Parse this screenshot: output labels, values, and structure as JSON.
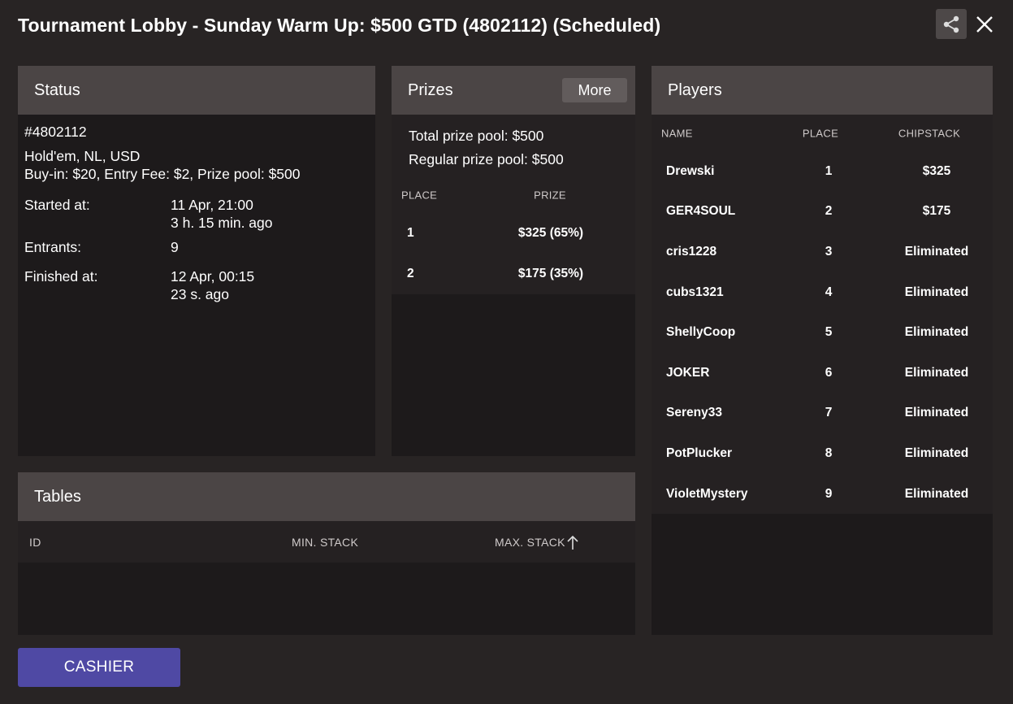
{
  "window": {
    "title": "Tournament Lobby - Sunday Warm Up: $500 GTD (4802112) (Scheduled)"
  },
  "status": {
    "header": "Status",
    "id": "#4802112",
    "game": "Hold'em, NL, USD",
    "buyin": "Buy-in: $20, Entry Fee: $2, Prize pool: $500",
    "started_label": "Started at:",
    "started_value": "11 Apr, 21:00",
    "started_ago": "3 h. 15 min. ago",
    "entrants_label": "Entrants:",
    "entrants_value": "9",
    "finished_label": "Finished at:",
    "finished_value": "12 Apr, 00:15",
    "finished_ago": "23 s. ago"
  },
  "prizes": {
    "header": "Prizes",
    "more_label": "More",
    "total_label": "Total prize pool:",
    "total_value": "$500",
    "regular_label": "Regular prize pool:",
    "regular_value": "$500",
    "col_place": "PLACE",
    "col_prize": "PRIZE",
    "rows": [
      {
        "place": "1",
        "prize": "$325 (65%)"
      },
      {
        "place": "2",
        "prize": "$175 (35%)"
      }
    ]
  },
  "players": {
    "header": "Players",
    "col_name": "NAME",
    "col_place": "PLACE",
    "col_chipstack": "CHIPSTACK",
    "rows": [
      {
        "name": "Drewski",
        "place": "1",
        "chipstack": "$325"
      },
      {
        "name": "GER4SOUL",
        "place": "2",
        "chipstack": "$175"
      },
      {
        "name": "cris1228",
        "place": "3",
        "chipstack": "Eliminated"
      },
      {
        "name": "cubs1321",
        "place": "4",
        "chipstack": "Eliminated"
      },
      {
        "name": "ShellyCoop",
        "place": "5",
        "chipstack": "Eliminated"
      },
      {
        "name": "JOKER",
        "place": "6",
        "chipstack": "Eliminated"
      },
      {
        "name": "Sereny33",
        "place": "7",
        "chipstack": "Eliminated"
      },
      {
        "name": "PotPlucker",
        "place": "8",
        "chipstack": "Eliminated"
      },
      {
        "name": "VioletMystery",
        "place": "9",
        "chipstack": "Eliminated"
      }
    ]
  },
  "tables": {
    "header": "Tables",
    "col_id": "ID",
    "col_min": "MIN. STACK",
    "col_max": "MAX. STACK"
  },
  "footer": {
    "cashier_label": "CASHIER"
  },
  "icons": {
    "share": "share-icon",
    "close": "close-icon",
    "sort": "arrow-up-icon"
  },
  "colors": {
    "background": "#282424",
    "panel_header": "#4b4545",
    "panel_body": "#1d1a1b",
    "cashier": "#4f49a4"
  }
}
